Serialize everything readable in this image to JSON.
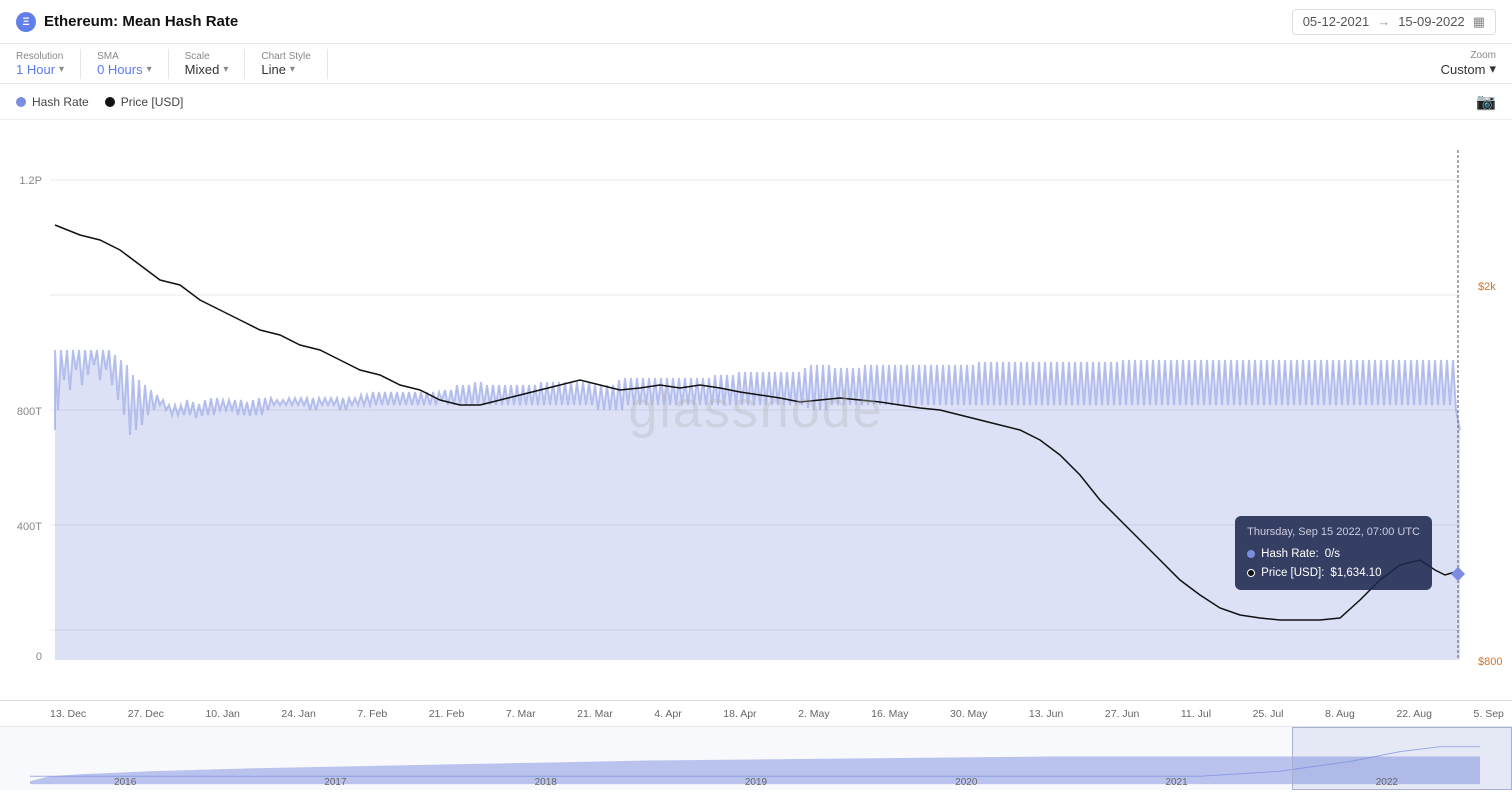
{
  "header": {
    "title": "Ethereum: Mean Hash Rate",
    "eth_icon": "Ξ",
    "date_from": "05-12-2021",
    "date_to": "15-09-2022",
    "calendar_icon": "📅"
  },
  "toolbar": {
    "resolution_label": "Resolution",
    "resolution_value": "1 Hour",
    "sma_label": "SMA",
    "sma_value": "0 Hours",
    "scale_label": "Scale",
    "scale_value": "Mixed",
    "chart_style_label": "Chart Style",
    "chart_style_value": "Line",
    "zoom_label": "Zoom",
    "zoom_value": "Custom"
  },
  "legend": {
    "hash_rate_label": "Hash Rate",
    "price_label": "Price [USD]"
  },
  "chart": {
    "y_labels_left": [
      "1.2P",
      "800T",
      "400T",
      "0"
    ],
    "y_labels_right": [
      "$2k",
      "$800"
    ],
    "x_labels": [
      "13. Dec",
      "27. Dec",
      "10. Jan",
      "24. Jan",
      "7. Feb",
      "21. Feb",
      "7. Mar",
      "21. Mar",
      "4. Apr",
      "18. Apr",
      "2. May",
      "16. May",
      "30. May",
      "13. Jun",
      "27. Jun",
      "11. Jul",
      "25. Jul",
      "8. Aug",
      "22. Aug",
      "5. Sep"
    ],
    "watermark": "glassnode"
  },
  "tooltip": {
    "title": "Thursday, Sep 15 2022, 07:00 UTC",
    "hash_rate_label": "Hash Rate:",
    "hash_rate_value": "0/s",
    "price_label": "Price [USD]:",
    "price_value": "$1,634.10"
  },
  "mini_chart": {
    "x_labels": [
      "2016",
      "2017",
      "2018",
      "2019",
      "2020",
      "2021",
      "2022"
    ]
  }
}
